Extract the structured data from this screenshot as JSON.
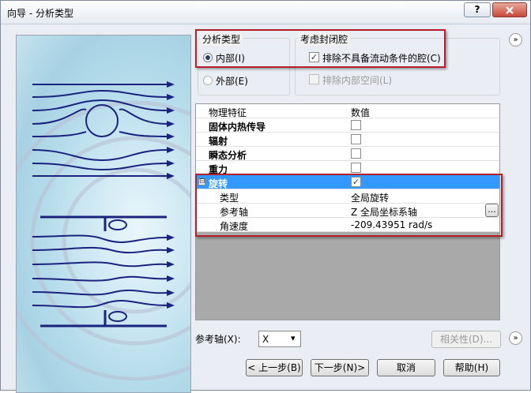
{
  "window": {
    "title": "向导 - 分析类型",
    "help": "?"
  },
  "analysis_type": {
    "title": "分析类型",
    "internal_label": "内部(I)",
    "external_label": "外部(E)",
    "selected": "internal"
  },
  "closed_cavities": {
    "title": "考虑封闭腔",
    "exclude_label": "排除不具备流动条件的腔(C)",
    "exclude_checked": true,
    "internal_space_label": "排除内部空间(L)",
    "internal_space_checked": false
  },
  "grid": {
    "headers": [
      "物理特征",
      "数值"
    ],
    "rows": [
      {
        "name": "固体内热传导",
        "checked": false
      },
      {
        "name": "辐射",
        "checked": false
      },
      {
        "name": "瞬态分析",
        "checked": false
      },
      {
        "name": "重力",
        "checked": false
      }
    ],
    "rotation": {
      "name": "旋转",
      "expand": "⊟",
      "checked": true,
      "children": [
        {
          "name": "类型",
          "value": "全局旋转"
        },
        {
          "name": "参考轴",
          "value": "Z  全局坐标系轴",
          "button": "..."
        },
        {
          "name": "角速度",
          "value": "-209.43951 rad/s"
        }
      ]
    }
  },
  "reference_axis": {
    "label": "参考轴(X):",
    "value": "X"
  },
  "buttons": {
    "dependency": "相关性(D)...",
    "back": "< 上一步(B)",
    "next": "下一步(N)>",
    "cancel": "取消",
    "help": "帮助(H)"
  },
  "icons": {
    "chevron": "»",
    "dropdown": "▾",
    "check": "✓"
  },
  "colors": {
    "highlight": "#3399ff",
    "annotation": "#b4202a",
    "flow": "#1a237e"
  }
}
